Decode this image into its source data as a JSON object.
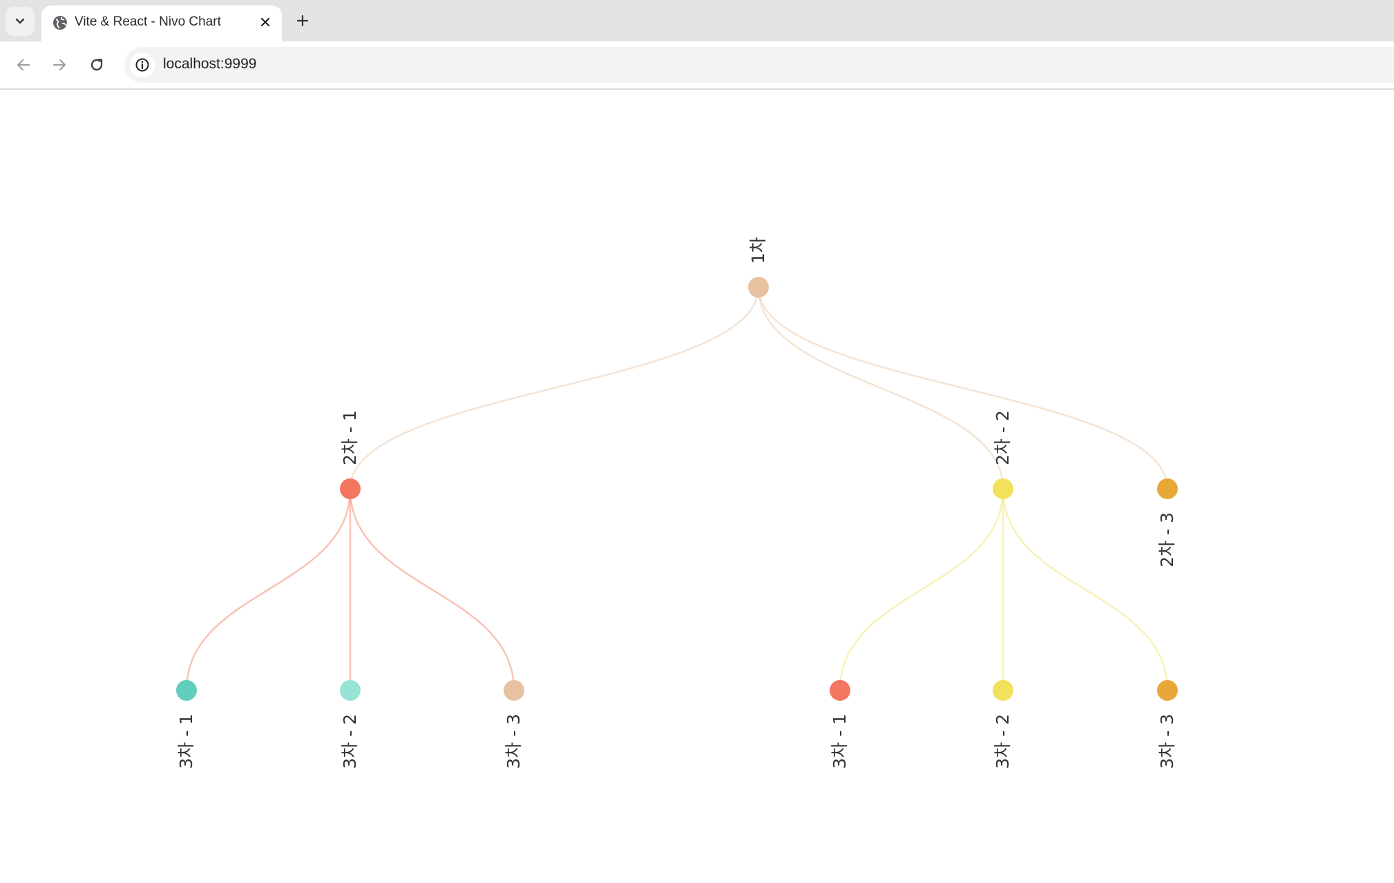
{
  "browser": {
    "tab": {
      "title": "Vite & React - Nivo Chart",
      "favicon": "globe-icon"
    },
    "icons": {
      "tab_list": "chevron-down-icon",
      "close": "close-icon",
      "new_tab": "plus-icon",
      "back": "arrow-left-icon",
      "forward": "arrow-right-icon",
      "reload": "reload-icon",
      "site_info": "info-icon"
    },
    "address_bar": {
      "url": "localhost:9999"
    }
  },
  "tree": {
    "root": {
      "label": "1차",
      "color": "#e8c1a0"
    },
    "level2": [
      {
        "label": "2차 - 1",
        "color": "#f47560",
        "children": [
          {
            "label": "3차 - 1",
            "color": "#61cdbb"
          },
          {
            "label": "3차 - 2",
            "color": "#97e3d5"
          },
          {
            "label": "3차 - 3",
            "color": "#e8c1a0"
          }
        ]
      },
      {
        "label": "2차 - 2",
        "color": "#f1e15b",
        "children": [
          {
            "label": "3차 - 1",
            "color": "#f47560"
          },
          {
            "label": "3차 - 2",
            "color": "#f1e15b"
          },
          {
            "label": "3차 - 3",
            "color": "#e8a838"
          }
        ]
      },
      {
        "label": "2차 - 3",
        "color": "#e8a838",
        "children": []
      }
    ]
  }
}
